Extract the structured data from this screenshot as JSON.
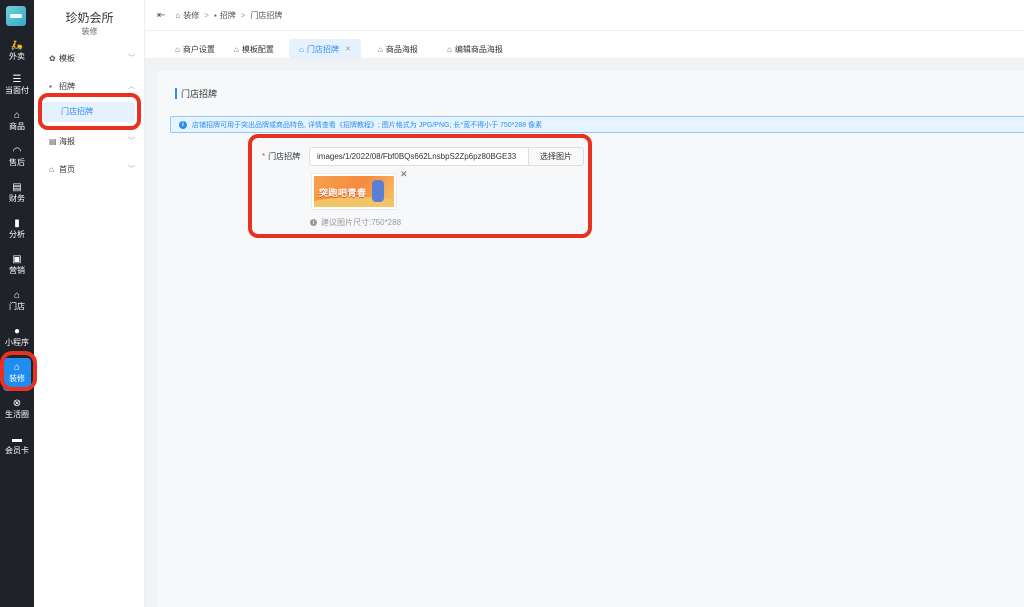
{
  "rail": {
    "items": [
      {
        "label": "外卖",
        "icon": "scooter-icon"
      },
      {
        "label": "当面付",
        "icon": "list-icon"
      },
      {
        "label": "商品",
        "icon": "shop-icon"
      },
      {
        "label": "售后",
        "icon": "headset-icon"
      },
      {
        "label": "财务",
        "icon": "finance-icon"
      },
      {
        "label": "分析",
        "icon": "chart-icon"
      },
      {
        "label": "营销",
        "icon": "gift-icon"
      },
      {
        "label": "门店",
        "icon": "store-icon"
      },
      {
        "label": "小程序",
        "icon": "wechat-icon"
      },
      {
        "label": "装修",
        "icon": "decor-icon",
        "active": true
      },
      {
        "label": "生活圈",
        "icon": "circle-icon"
      },
      {
        "label": "会员卡",
        "icon": "card-icon"
      }
    ]
  },
  "sidebar": {
    "title": "珍奶会所",
    "subtitle": "装修",
    "groups": [
      {
        "label": "模板",
        "icon": "gear-icon",
        "expanded": false
      },
      {
        "label": "招牌",
        "icon": "sign-icon",
        "expanded": true,
        "children": [
          {
            "label": "门店招牌",
            "active": true
          }
        ]
      },
      {
        "label": "海报",
        "icon": "poster-icon",
        "expanded": false
      },
      {
        "label": "首页",
        "icon": "home-icon",
        "expanded": false
      }
    ]
  },
  "breadcrumb": [
    "装修",
    "招牌",
    "门店招牌"
  ],
  "tabs": [
    {
      "label": "商户设置",
      "active": false
    },
    {
      "label": "模板配置",
      "active": false
    },
    {
      "label": "门店招牌",
      "active": true
    },
    {
      "label": "商品海报",
      "active": false
    },
    {
      "label": "编辑商品海报",
      "active": false
    }
  ],
  "section_title": "门店招牌",
  "tip": "店铺招牌可用于突出品牌或商品特色, 详情查看《招牌教程》; 图片格式为 JPG/PNG; 长*宽不得小于 750*288 像素",
  "form": {
    "label": "门店招牌",
    "value": "images/1/2022/08/Fbf0BQs662LnsbpS2Zp6pz80BGE33",
    "choose_label": "选择图片",
    "preview_text": "突跑吧青春",
    "hint": "建议图片尺寸:750*288"
  },
  "colors": {
    "accent": "#2d8cf0",
    "rail_bg": "#1f2329",
    "annotation": "#e8321f"
  }
}
